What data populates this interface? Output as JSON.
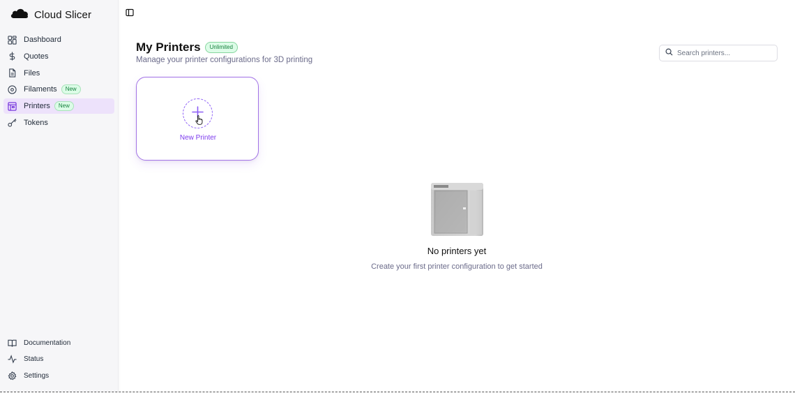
{
  "app": {
    "name": "Cloud Slicer",
    "logo_icon": "cloud-icon"
  },
  "sidebar": {
    "items": [
      {
        "label": "Dashboard",
        "icon": "dashboard-grid-icon"
      },
      {
        "label": "Quotes",
        "icon": "dollar-icon"
      },
      {
        "label": "Files",
        "icon": "file-icon"
      },
      {
        "label": "Filaments",
        "icon": "spool-icon",
        "badge": "New"
      },
      {
        "label": "Printers",
        "icon": "printer-icon",
        "badge": "New",
        "active": true
      },
      {
        "label": "Tokens",
        "icon": "key-icon"
      }
    ],
    "bottom_items": [
      {
        "label": "Documentation",
        "icon": "book-icon"
      },
      {
        "label": "Status",
        "icon": "activity-icon"
      },
      {
        "label": "Settings",
        "icon": "gear-icon"
      }
    ]
  },
  "header": {
    "title": "My Printers",
    "plan_badge": "Unlimited",
    "subtitle": "Manage your printer configurations for 3D printing"
  },
  "search": {
    "placeholder": "Search printers..."
  },
  "new_card": {
    "label": "New Printer"
  },
  "empty_state": {
    "title": "No printers yet",
    "description": "Create your first printer configuration to get started"
  },
  "colors": {
    "accent": "#7c3aed",
    "active_bg": "#ede2fb",
    "badge_green": "#15803d",
    "badge_green_bg": "#dcfce7"
  }
}
